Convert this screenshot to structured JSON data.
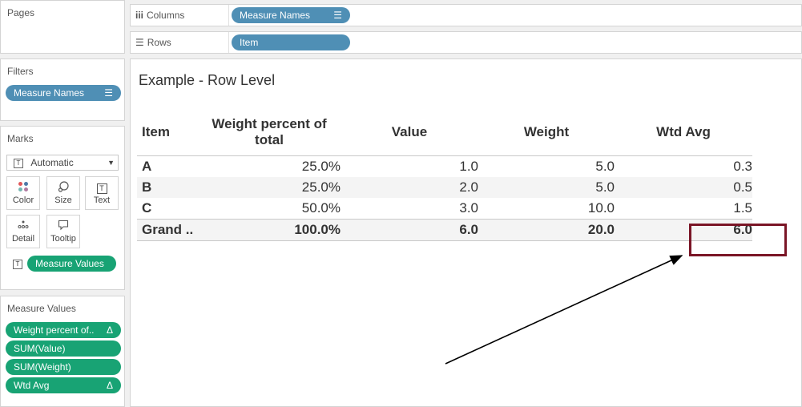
{
  "pages": {
    "title": "Pages"
  },
  "filters": {
    "title": "Filters",
    "pills": [
      {
        "label": "Measure Names"
      }
    ]
  },
  "marks": {
    "title": "Marks",
    "type_select": "Automatic",
    "buttons": [
      {
        "label": "Color",
        "icon": "color-dots-icon"
      },
      {
        "label": "Size",
        "icon": "size-icon"
      },
      {
        "label": "Text",
        "icon": "text-icon"
      },
      {
        "label": "Detail",
        "icon": "detail-icon"
      },
      {
        "label": "Tooltip",
        "icon": "tooltip-icon"
      }
    ],
    "text_pill": "Measure Values"
  },
  "measure_values": {
    "title": "Measure Values",
    "pills": [
      {
        "label": "Weight percent of..",
        "delta": "Δ"
      },
      {
        "label": "SUM(Value)",
        "delta": ""
      },
      {
        "label": "SUM(Weight)",
        "delta": ""
      },
      {
        "label": "Wtd Avg",
        "delta": "Δ"
      }
    ]
  },
  "shelves": {
    "columns": {
      "label": "Columns",
      "pill": "Measure Names"
    },
    "rows": {
      "label": "Rows",
      "pill": "Item"
    }
  },
  "view": {
    "title": "Example - Row Level",
    "headers": [
      "Item",
      "Weight percent of total",
      "Value",
      "Weight",
      "Wtd Avg"
    ],
    "rows": [
      [
        "A",
        "25.0%",
        "1.0",
        "5.0",
        "0.3"
      ],
      [
        "B",
        "25.0%",
        "2.0",
        "5.0",
        "0.5"
      ],
      [
        "C",
        "50.0%",
        "3.0",
        "10.0",
        "1.5"
      ]
    ],
    "grand": [
      "Grand ..",
      "100.0%",
      "6.0",
      "20.0",
      "6.0"
    ]
  },
  "colors": {
    "pill_blue": "#4f8fb5",
    "pill_green": "#18a374",
    "highlight": "#7a1526",
    "arrow": "#000000"
  }
}
